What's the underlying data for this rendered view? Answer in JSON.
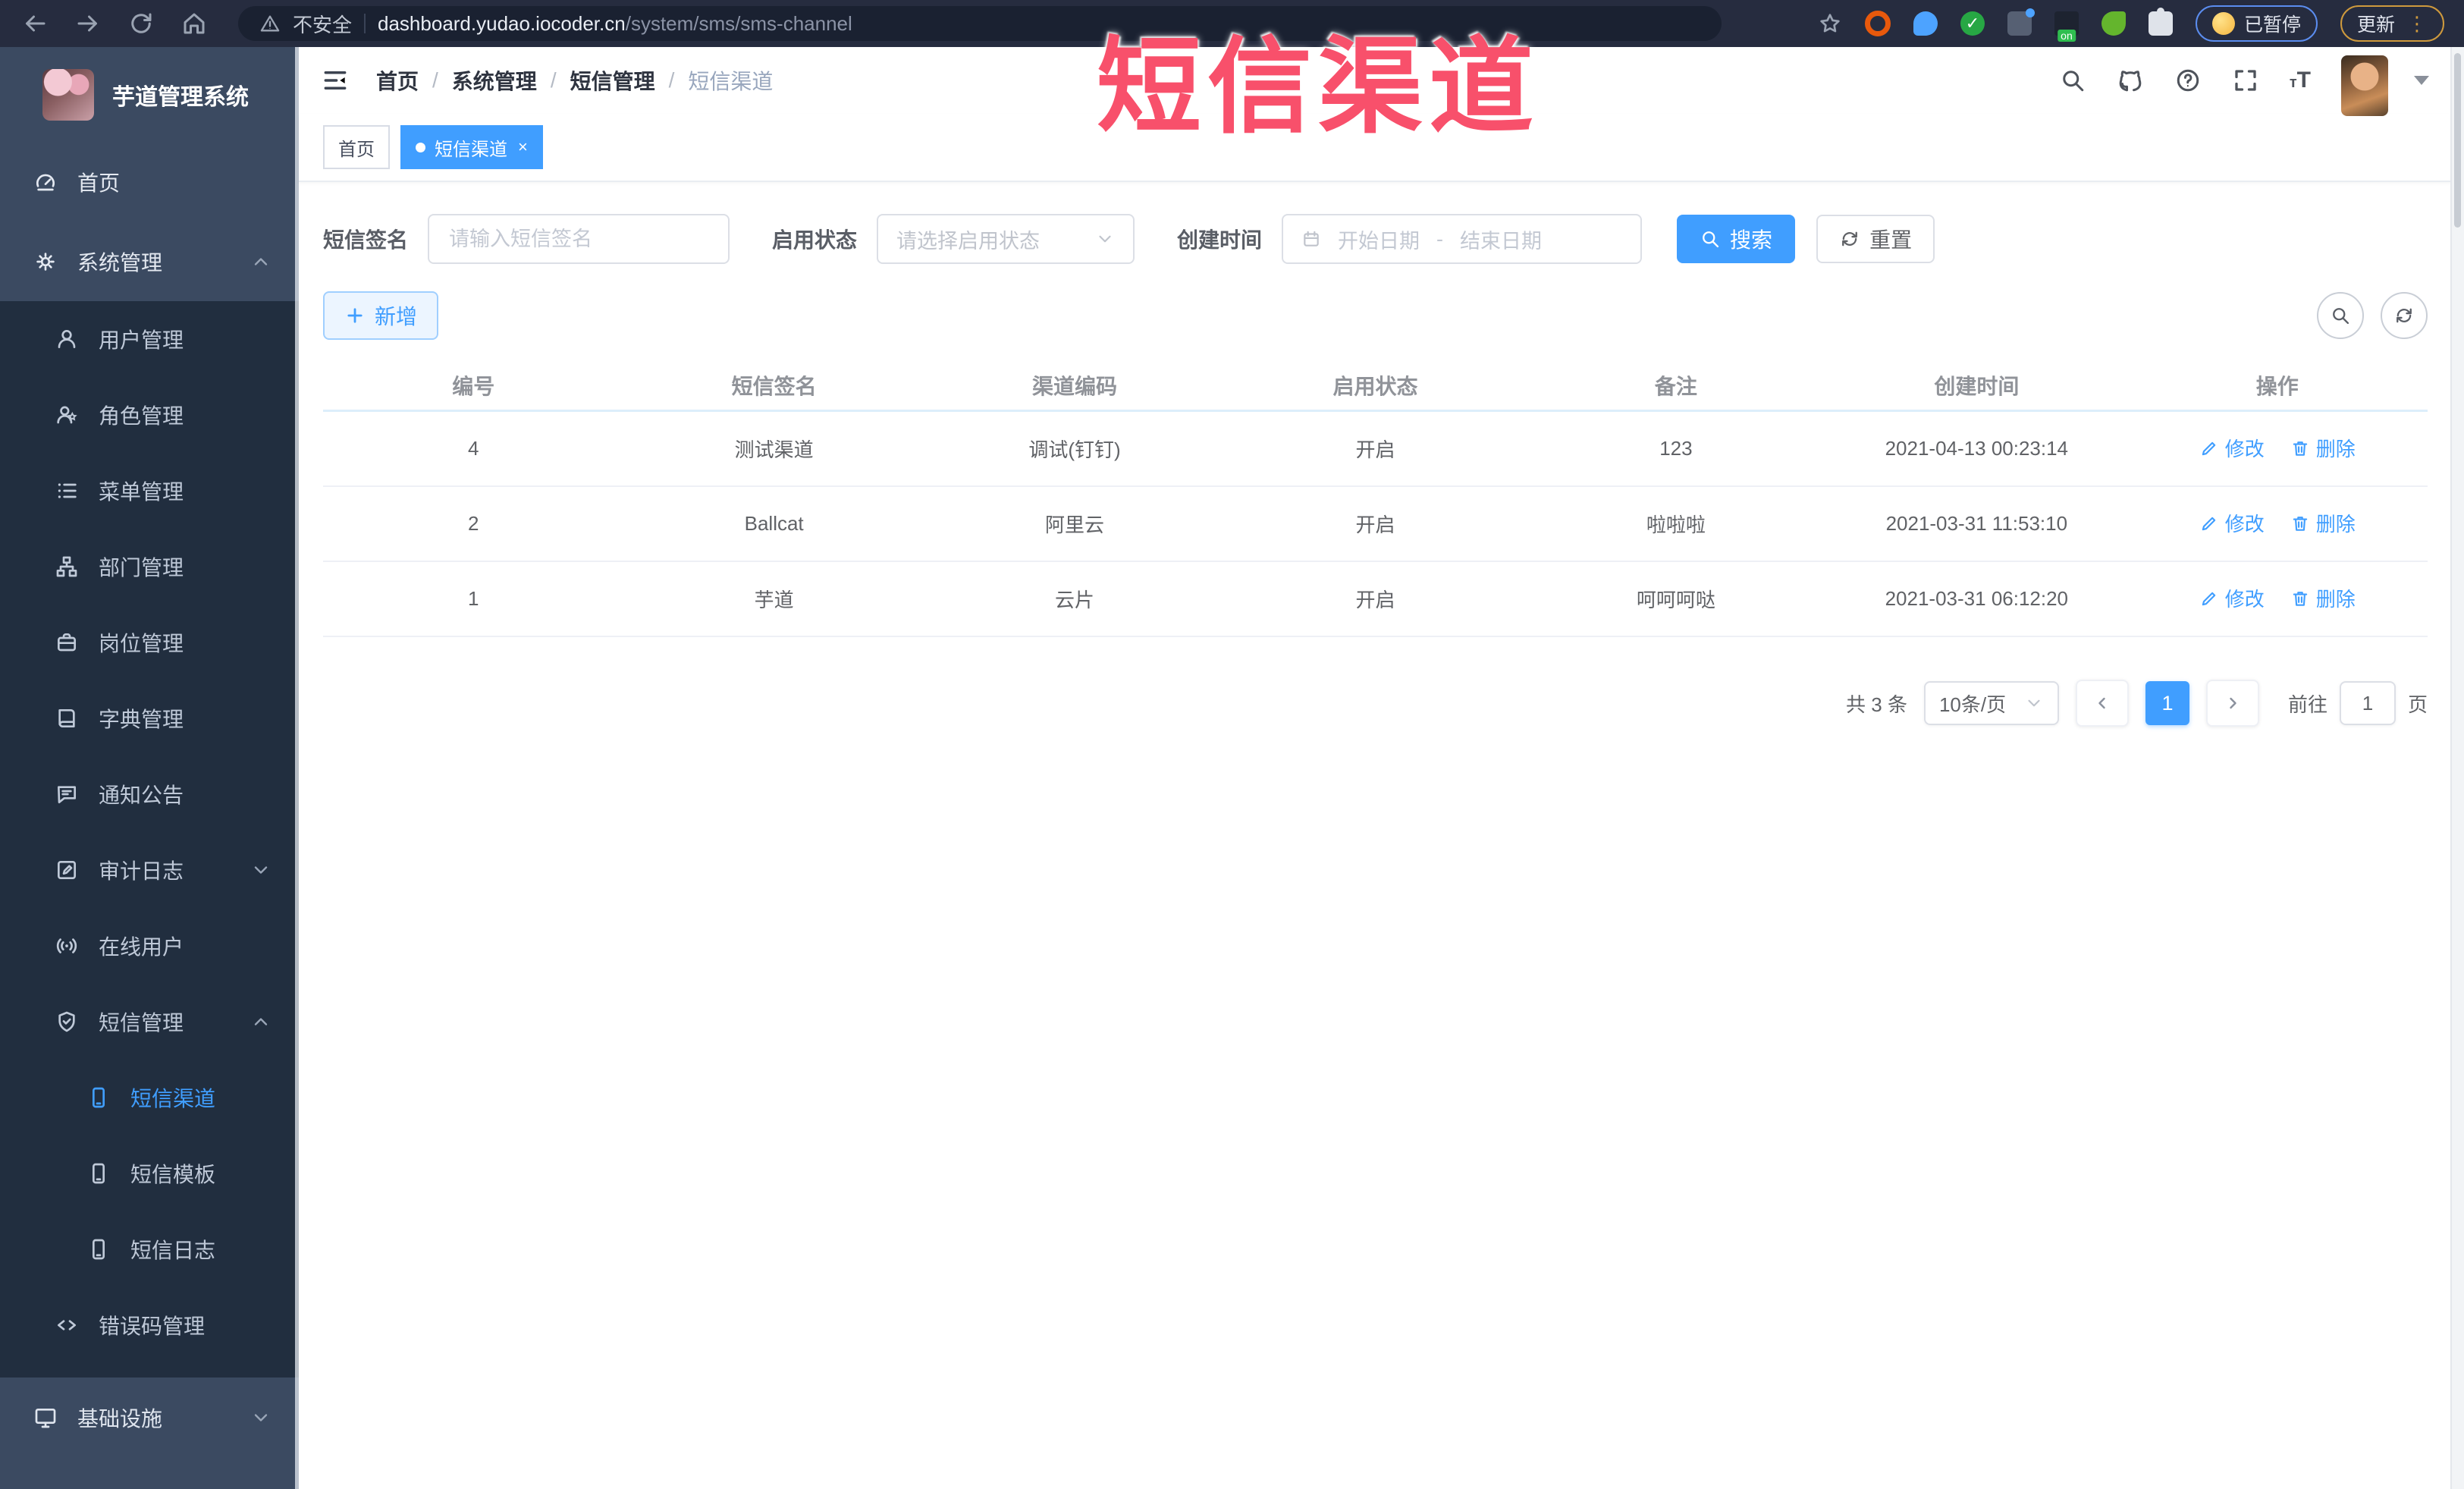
{
  "annotation": {
    "text": "短信渠道"
  },
  "browser": {
    "security_label": "不安全",
    "url_host": "dashboard.yudao.iocoder.cn",
    "url_path": "/system/sms/sms-channel",
    "paused_label": "已暂停",
    "update_label": "更新"
  },
  "sidebar": {
    "title": "芋道管理系统",
    "menu": [
      {
        "label": "首页"
      },
      {
        "label": "系统管理"
      },
      {
        "label": "用户管理"
      },
      {
        "label": "角色管理"
      },
      {
        "label": "菜单管理"
      },
      {
        "label": "部门管理"
      },
      {
        "label": "岗位管理"
      },
      {
        "label": "字典管理"
      },
      {
        "label": "通知公告"
      },
      {
        "label": "审计日志"
      },
      {
        "label": "在线用户"
      },
      {
        "label": "短信管理"
      },
      {
        "label": "短信渠道"
      },
      {
        "label": "短信模板"
      },
      {
        "label": "短信日志"
      },
      {
        "label": "错误码管理"
      },
      {
        "label": "基础设施"
      }
    ]
  },
  "header": {
    "breadcrumb": [
      "首页",
      "系统管理",
      "短信管理",
      "短信渠道"
    ],
    "separator": "/"
  },
  "tags": [
    {
      "label": "首页"
    },
    {
      "label": "短信渠道"
    }
  ],
  "filters": {
    "signature_label": "短信签名",
    "signature_placeholder": "请输入短信签名",
    "status_label": "启用状态",
    "status_placeholder": "请选择启用状态",
    "time_label": "创建时间",
    "date_start_placeholder": "开始日期",
    "date_separator": "-",
    "date_end_placeholder": "结束日期",
    "search_label": "搜索",
    "reset_label": "重置"
  },
  "toolbar": {
    "add_label": "新增"
  },
  "table": {
    "columns": [
      "编号",
      "短信签名",
      "渠道编码",
      "启用状态",
      "备注",
      "创建时间",
      "操作"
    ],
    "modify_label": "修改",
    "delete_label": "删除",
    "rows": [
      {
        "cells": [
          "4",
          "测试渠道",
          "调试(钉钉)",
          "开启",
          "123",
          "2021-04-13 00:23:14"
        ]
      },
      {
        "cells": [
          "2",
          "Ballcat",
          "阿里云",
          "开启",
          "啦啦啦",
          "2021-03-31 11:53:10"
        ]
      },
      {
        "cells": [
          "1",
          "芋道",
          "云片",
          "开启",
          "呵呵呵哒",
          "2021-03-31 06:12:20"
        ]
      }
    ]
  },
  "pagination": {
    "total_text": "共 3 条",
    "page_size_text": "10条/页",
    "current_page": "1",
    "goto_label": "前往",
    "goto_value": "1",
    "page_unit_label": "页"
  },
  "colors": {
    "primary": "#409eff",
    "annotation": "#f8506b"
  }
}
